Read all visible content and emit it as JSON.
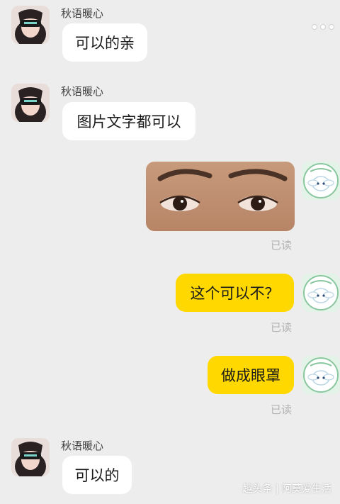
{
  "messages": [
    {
      "sender": "秋语暖心",
      "text": "可以的亲"
    },
    {
      "sender": "秋语暖心",
      "text": "图片文字都可以"
    },
    {
      "text": "这个可以不？",
      "status": "已读"
    },
    {
      "text": "做成眼罩",
      "status": "已读"
    },
    {
      "sender": "秋语暖心",
      "text": "可以的"
    }
  ],
  "photo_status": "已读",
  "watermark": "趣头条 | 阿莫爱生活",
  "colors": {
    "background": "#ededed",
    "outgoing_bubble": "#ffd800",
    "incoming_bubble": "#ffffff"
  },
  "icons": {
    "more": "more-dots-icon",
    "contact_avatar": "avatar-girl",
    "user_avatar": "avatar-cinnamoroll"
  }
}
